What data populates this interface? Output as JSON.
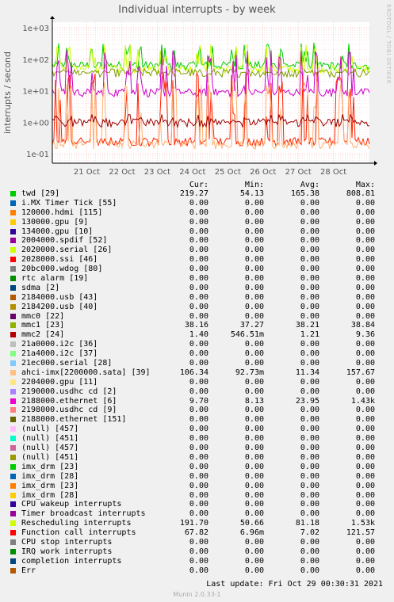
{
  "chart_data": {
    "type": "line",
    "title": "Individual interrupts - by week",
    "ylabel": "interrupts / second",
    "yscale": "log",
    "ylim": [
      0.05,
      1500
    ],
    "yticks": [
      "1e+03",
      "1e+02",
      "1e+01",
      "1e+00",
      "1e-01"
    ],
    "ytick_values": [
      1000,
      100,
      10,
      1,
      0.1
    ],
    "xticks": [
      "21 Oct",
      "22 Oct",
      "23 Oct",
      "24 Oct",
      "25 Oct",
      "26 Oct",
      "27 Oct",
      "28 Oct"
    ],
    "xlim": [
      "20 Oct 00:30",
      "29 Oct 00:30"
    ],
    "grid": true,
    "series": [
      {
        "name": "twd [29]",
        "color": "#00cc00",
        "base": 65,
        "spike": 350
      },
      {
        "name": "Rescheduling interrupts",
        "color": "#ccff00",
        "base": 50,
        "spike": 300
      },
      {
        "name": "mmc1 [23]",
        "color": "#7fa000",
        "base": 38,
        "spike": 39
      },
      {
        "name": "2188000.ethernet [6]",
        "color": "#cc00cc",
        "base": 9,
        "spike": 200
      },
      {
        "name": "Function call interrupts",
        "color": "#ff2000",
        "base": 0.25,
        "spike": 40
      },
      {
        "name": "ahci-imx[2200000.sata] [39]",
        "color": "#ffb070",
        "base": 0.2,
        "spike": 20
      },
      {
        "name": "mmc2 [24]",
        "color": "#990000",
        "base": 1.0,
        "spike": 1.8
      }
    ]
  },
  "side_label": "RRDTOOL / TOBI OETIKER",
  "legend": {
    "headers": [
      "Cur:",
      "Min:",
      "Avg:",
      "Max:"
    ],
    "rows": [
      {
        "name": "twd [29]",
        "color": "#00cc00",
        "cur": "219.27",
        "min": "54.13",
        "avg": "165.38",
        "max": "808.81"
      },
      {
        "name": "i.MX Timer Tick [55]",
        "color": "#0066b3",
        "cur": "0.00",
        "min": "0.00",
        "avg": "0.00",
        "max": "0.00"
      },
      {
        "name": "120000.hdmi [115]",
        "color": "#ff8000",
        "cur": "0.00",
        "min": "0.00",
        "avg": "0.00",
        "max": "0.00"
      },
      {
        "name": "130000.gpu [9]",
        "color": "#ffcc00",
        "cur": "0.00",
        "min": "0.00",
        "avg": "0.00",
        "max": "0.00"
      },
      {
        "name": "134000.gpu [10]",
        "color": "#330099",
        "cur": "0.00",
        "min": "0.00",
        "avg": "0.00",
        "max": "0.00"
      },
      {
        "name": "2004000.spdif [52]",
        "color": "#990099",
        "cur": "0.00",
        "min": "0.00",
        "avg": "0.00",
        "max": "0.00"
      },
      {
        "name": "2020000.serial [26]",
        "color": "#ccff00",
        "cur": "0.00",
        "min": "0.00",
        "avg": "0.00",
        "max": "0.00"
      },
      {
        "name": "2028000.ssi [46]",
        "color": "#ff0000",
        "cur": "0.00",
        "min": "0.00",
        "avg": "0.00",
        "max": "0.00"
      },
      {
        "name": "20bc000.wdog [80]",
        "color": "#808080",
        "cur": "0.00",
        "min": "0.00",
        "avg": "0.00",
        "max": "0.00"
      },
      {
        "name": "rtc alarm [19]",
        "color": "#008f00",
        "cur": "0.00",
        "min": "0.00",
        "avg": "0.00",
        "max": "0.00"
      },
      {
        "name": "sdma [2]",
        "color": "#00487d",
        "cur": "0.00",
        "min": "0.00",
        "avg": "0.00",
        "max": "0.00"
      },
      {
        "name": "2184000.usb [43]",
        "color": "#b35a00",
        "cur": "0.00",
        "min": "0.00",
        "avg": "0.00",
        "max": "0.00"
      },
      {
        "name": "2184200.usb [40]",
        "color": "#b38f00",
        "cur": "0.00",
        "min": "0.00",
        "avg": "0.00",
        "max": "0.00"
      },
      {
        "name": "mmc0 [22]",
        "color": "#6b006b",
        "cur": "0.00",
        "min": "0.00",
        "avg": "0.00",
        "max": "0.00"
      },
      {
        "name": "mmc1 [23]",
        "color": "#8fb300",
        "cur": "38.16",
        "min": "37.27",
        "avg": "38.21",
        "max": "38.84"
      },
      {
        "name": "mmc2 [24]",
        "color": "#b30000",
        "cur": "1.40",
        "min": "546.51m",
        "avg": "1.21",
        "max": "9.36"
      },
      {
        "name": "21a0000.i2c [36]",
        "color": "#bebebe",
        "cur": "0.00",
        "min": "0.00",
        "avg": "0.00",
        "max": "0.00"
      },
      {
        "name": "21a4000.i2c [37]",
        "color": "#80ff80",
        "cur": "0.00",
        "min": "0.00",
        "avg": "0.00",
        "max": "0.00"
      },
      {
        "name": "21ec000.serial [28]",
        "color": "#80c9ff",
        "cur": "0.00",
        "min": "0.00",
        "avg": "0.00",
        "max": "0.00"
      },
      {
        "name": "ahci-imx[2200000.sata] [39]",
        "color": "#ffc080",
        "cur": "106.34",
        "min": "92.73m",
        "avg": "11.34",
        "max": "157.67"
      },
      {
        "name": "2204000.gpu [11]",
        "color": "#ffe680",
        "cur": "0.00",
        "min": "0.00",
        "avg": "0.00",
        "max": "0.00"
      },
      {
        "name": "2190000.usdhc cd [2]",
        "color": "#aa80ff",
        "cur": "0.00",
        "min": "0.00",
        "avg": "0.00",
        "max": "0.00"
      },
      {
        "name": "2188000.ethernet [6]",
        "color": "#ee00cc",
        "cur": "9.70",
        "min": "8.13",
        "avg": "23.95",
        "max": "1.43k"
      },
      {
        "name": "2198000.usdhc cd [9]",
        "color": "#ff8080",
        "cur": "0.00",
        "min": "0.00",
        "avg": "0.00",
        "max": "0.00"
      },
      {
        "name": "2188000.ethernet [151]",
        "color": "#666600",
        "cur": "0.00",
        "min": "0.00",
        "avg": "0.00",
        "max": "0.00"
      },
      {
        "name": "(null) [457]",
        "color": "#ffbfff",
        "cur": "0.00",
        "min": "0.00",
        "avg": "0.00",
        "max": "0.00"
      },
      {
        "name": "(null) [451]",
        "color": "#00ffcc",
        "cur": "0.00",
        "min": "0.00",
        "avg": "0.00",
        "max": "0.00"
      },
      {
        "name": "(null) [457]",
        "color": "#cc6699",
        "cur": "0.00",
        "min": "0.00",
        "avg": "0.00",
        "max": "0.00"
      },
      {
        "name": "(null) [451]",
        "color": "#999900",
        "cur": "0.00",
        "min": "0.00",
        "avg": "0.00",
        "max": "0.00"
      },
      {
        "name": "imx_drm [23]",
        "color": "#00cc00",
        "cur": "0.00",
        "min": "0.00",
        "avg": "0.00",
        "max": "0.00"
      },
      {
        "name": "imx_drm [28]",
        "color": "#0066b3",
        "cur": "0.00",
        "min": "0.00",
        "avg": "0.00",
        "max": "0.00"
      },
      {
        "name": "imx_drm [23]",
        "color": "#ff8000",
        "cur": "0.00",
        "min": "0.00",
        "avg": "0.00",
        "max": "0.00"
      },
      {
        "name": "imx_drm [28]",
        "color": "#ffcc00",
        "cur": "0.00",
        "min": "0.00",
        "avg": "0.00",
        "max": "0.00"
      },
      {
        "name": "CPU wakeup interrupts",
        "color": "#330099",
        "cur": "0.00",
        "min": "0.00",
        "avg": "0.00",
        "max": "0.00"
      },
      {
        "name": "Timer broadcast interrupts",
        "color": "#990099",
        "cur": "0.00",
        "min": "0.00",
        "avg": "0.00",
        "max": "0.00"
      },
      {
        "name": "Rescheduling interrupts",
        "color": "#ccff00",
        "cur": "191.70",
        "min": "50.66",
        "avg": "81.18",
        "max": "1.53k"
      },
      {
        "name": "Function call interrupts",
        "color": "#ff0000",
        "cur": "67.82",
        "min": "6.96m",
        "avg": "7.02",
        "max": "121.57"
      },
      {
        "name": "CPU stop interrupts",
        "color": "#808080",
        "cur": "0.00",
        "min": "0.00",
        "avg": "0.00",
        "max": "0.00"
      },
      {
        "name": "IRQ work interrupts",
        "color": "#008f00",
        "cur": "0.00",
        "min": "0.00",
        "avg": "0.00",
        "max": "0.00"
      },
      {
        "name": "completion interrupts",
        "color": "#00487d",
        "cur": "0.00",
        "min": "0.00",
        "avg": "0.00",
        "max": "0.00"
      },
      {
        "name": "Err",
        "color": "#b35a00",
        "cur": "0.00",
        "min": "0.00",
        "avg": "0.00",
        "max": "0.00"
      }
    ]
  },
  "last_update": "Last update:  Fri Oct 29 00:30:31 2021",
  "footer": "Munin 2.0.33-1"
}
